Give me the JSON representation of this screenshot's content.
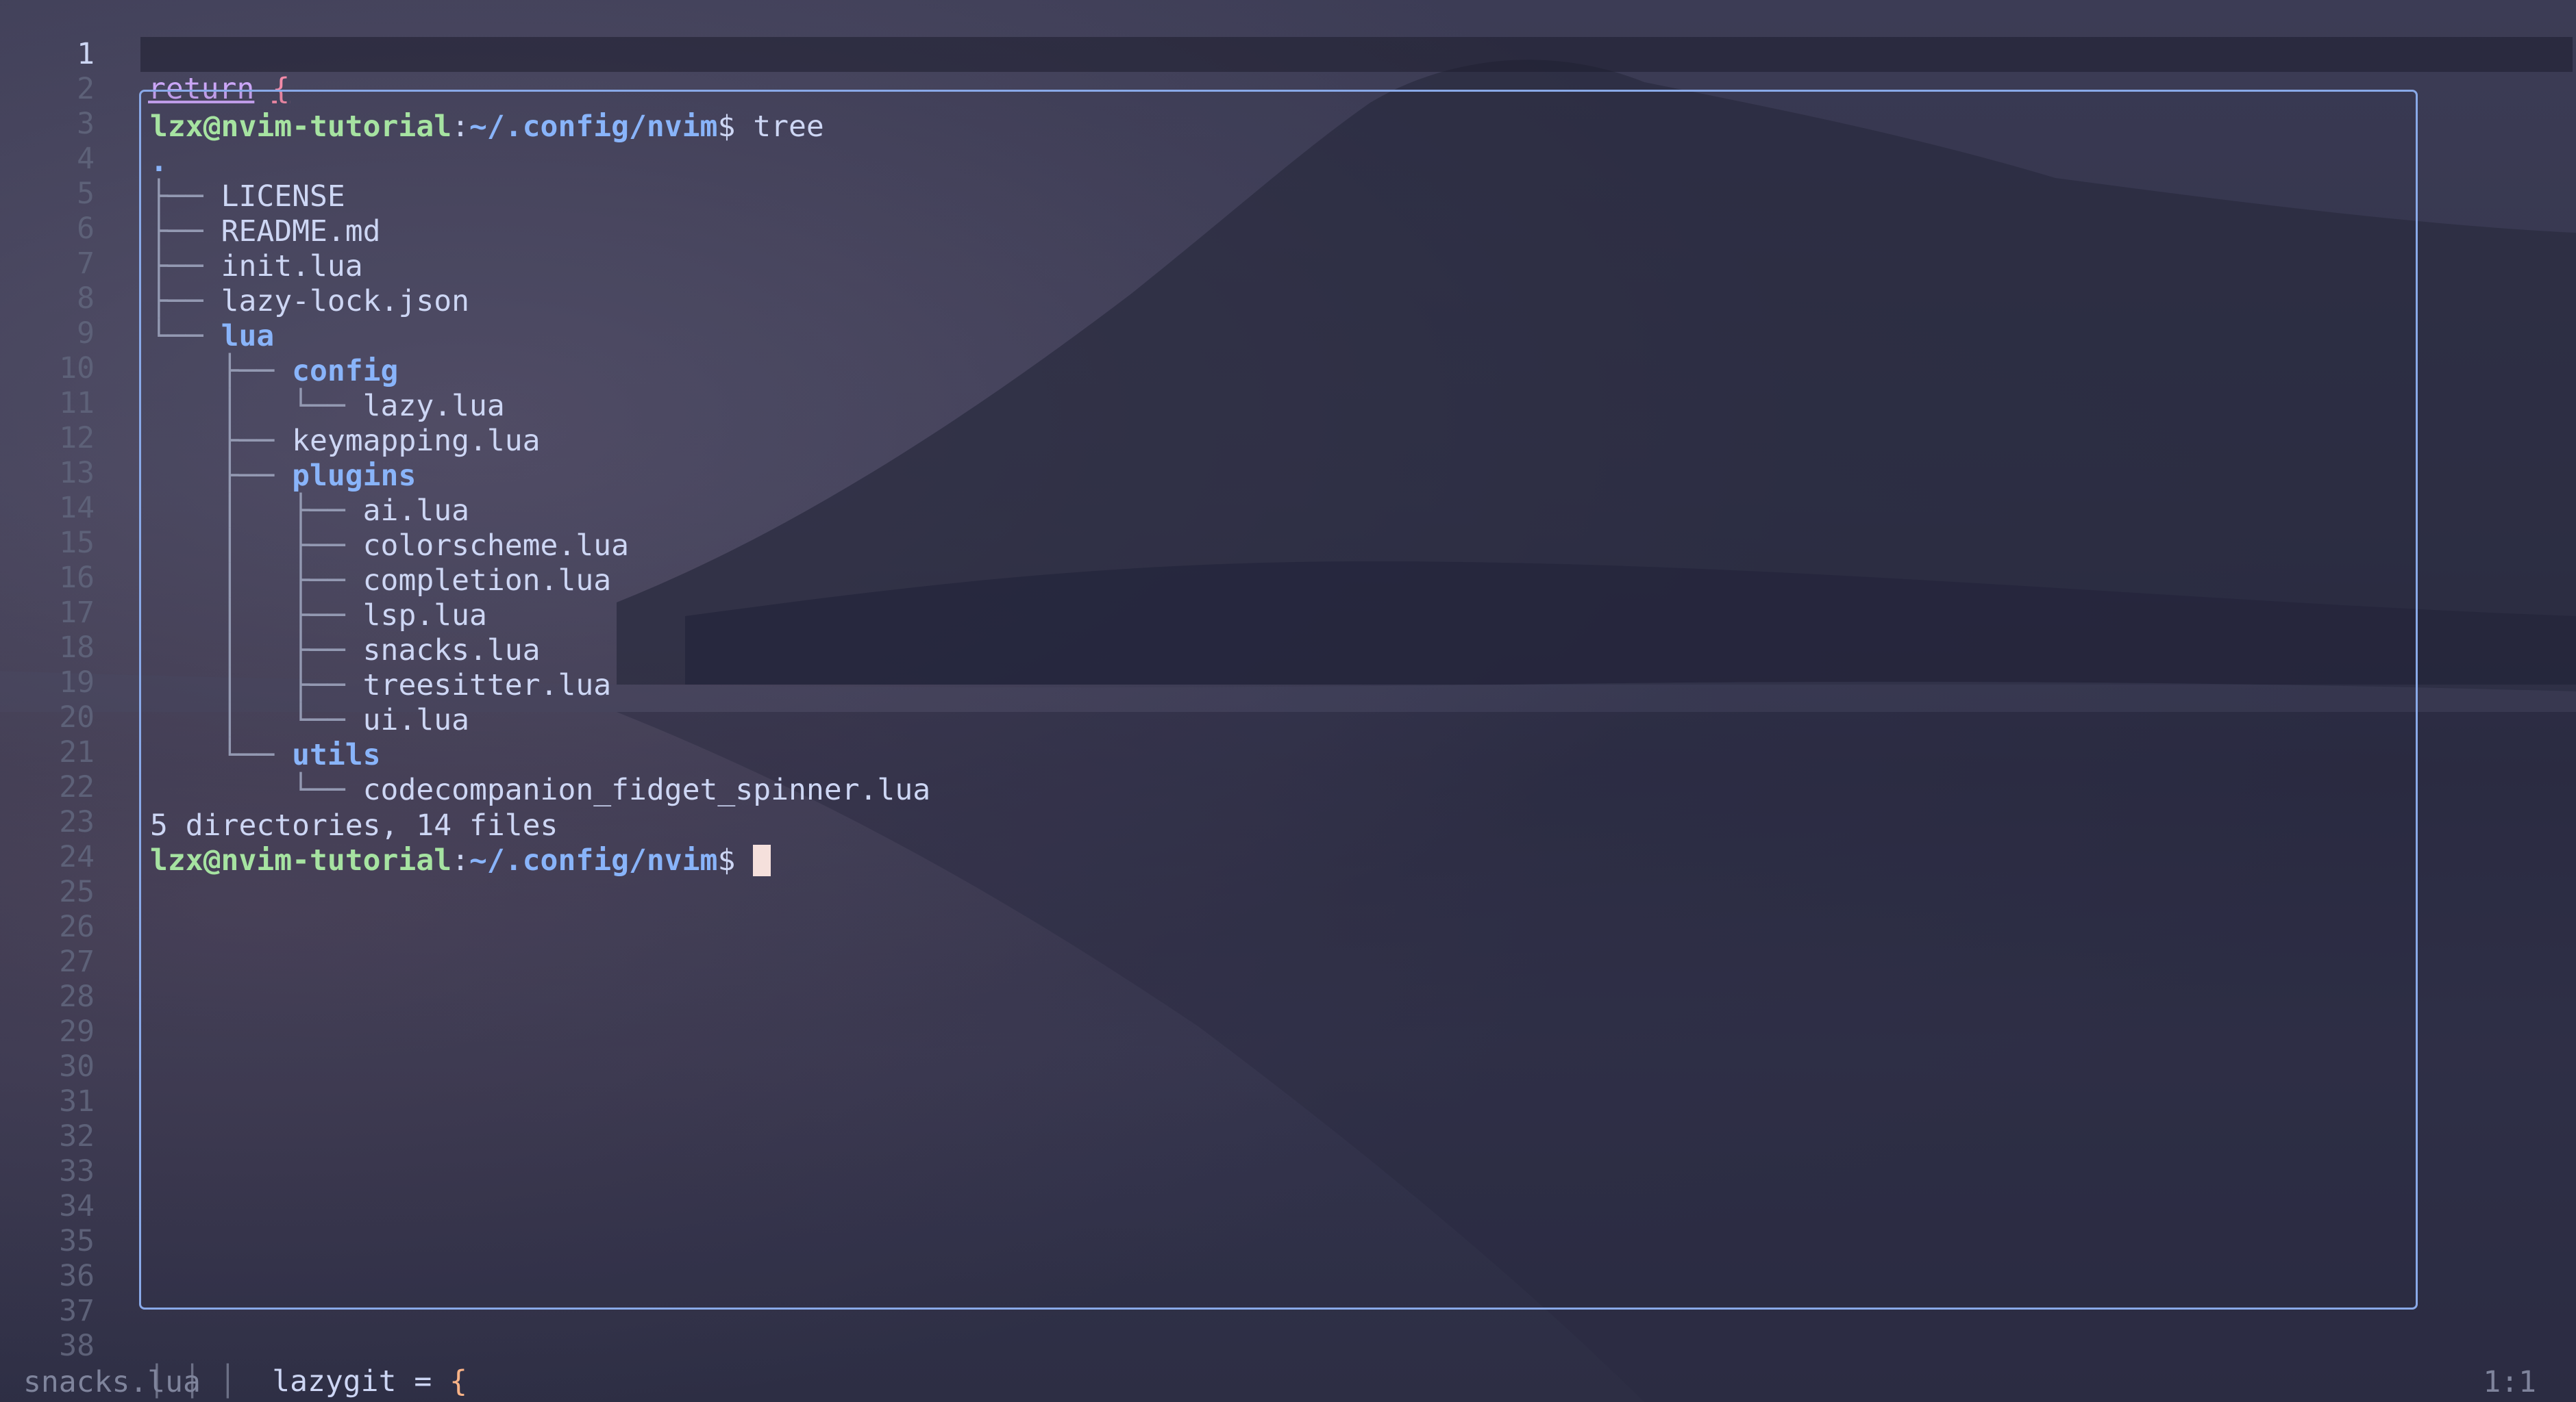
{
  "editor": {
    "line_numbers": [
      "1",
      "2",
      "3",
      "4",
      "5",
      "6",
      "7",
      "8",
      "9",
      "10",
      "11",
      "12",
      "13",
      "14",
      "15",
      "16",
      "17",
      "18",
      "19",
      "20",
      "21",
      "22",
      "23",
      "24",
      "25",
      "26",
      "27",
      "28",
      "29",
      "30",
      "31",
      "32",
      "33",
      "34",
      "35",
      "36",
      "37",
      "38"
    ],
    "line1": {
      "keyword": "return",
      "brace": "{"
    },
    "line38": {
      "indent_guides": "│ │ │",
      "key": "lazygit",
      "op": " = ",
      "brace": "{"
    }
  },
  "terminal": {
    "prompt_user": "lzx@nvim-tutorial",
    "prompt_sep": ":",
    "prompt_path": "~/.config/nvim",
    "prompt_dollar": "$",
    "command": "tree",
    "tree": [
      {
        "guide": ".",
        "name": "",
        "type": "root"
      },
      {
        "guide": "├── ",
        "name": "LICENSE",
        "type": "file"
      },
      {
        "guide": "├── ",
        "name": "README.md",
        "type": "file"
      },
      {
        "guide": "├── ",
        "name": "init.lua",
        "type": "file"
      },
      {
        "guide": "├── ",
        "name": "lazy-lock.json",
        "type": "file"
      },
      {
        "guide": "└── ",
        "name": "lua",
        "type": "dir"
      },
      {
        "guide": "    ├── ",
        "name": "config",
        "type": "dir"
      },
      {
        "guide": "    │   └── ",
        "name": "lazy.lua",
        "type": "file"
      },
      {
        "guide": "    ├── ",
        "name": "keymapping.lua",
        "type": "file"
      },
      {
        "guide": "    ├── ",
        "name": "plugins",
        "type": "dir"
      },
      {
        "guide": "    │   ├── ",
        "name": "ai.lua",
        "type": "file"
      },
      {
        "guide": "    │   ├── ",
        "name": "colorscheme.lua",
        "type": "file"
      },
      {
        "guide": "    │   ├── ",
        "name": "completion.lua",
        "type": "file"
      },
      {
        "guide": "    │   ├── ",
        "name": "lsp.lua",
        "type": "file"
      },
      {
        "guide": "    │   ├── ",
        "name": "snacks.lua",
        "type": "file"
      },
      {
        "guide": "    │   ├── ",
        "name": "treesitter.lua",
        "type": "file"
      },
      {
        "guide": "    │   └── ",
        "name": "ui.lua",
        "type": "file"
      },
      {
        "guide": "    └── ",
        "name": "utils",
        "type": "dir"
      },
      {
        "guide": "        └── ",
        "name": "codecompanion_fidget_spinner.lua",
        "type": "file"
      }
    ],
    "summary": "5 directories, 14 files"
  },
  "statusline": {
    "filename": "snacks.lua",
    "position": "1:1"
  },
  "colors": {
    "border": "#89a9e8",
    "prompt": "#a6e3a1",
    "directory": "#89b4fa",
    "keyword": "#cba6f7"
  }
}
